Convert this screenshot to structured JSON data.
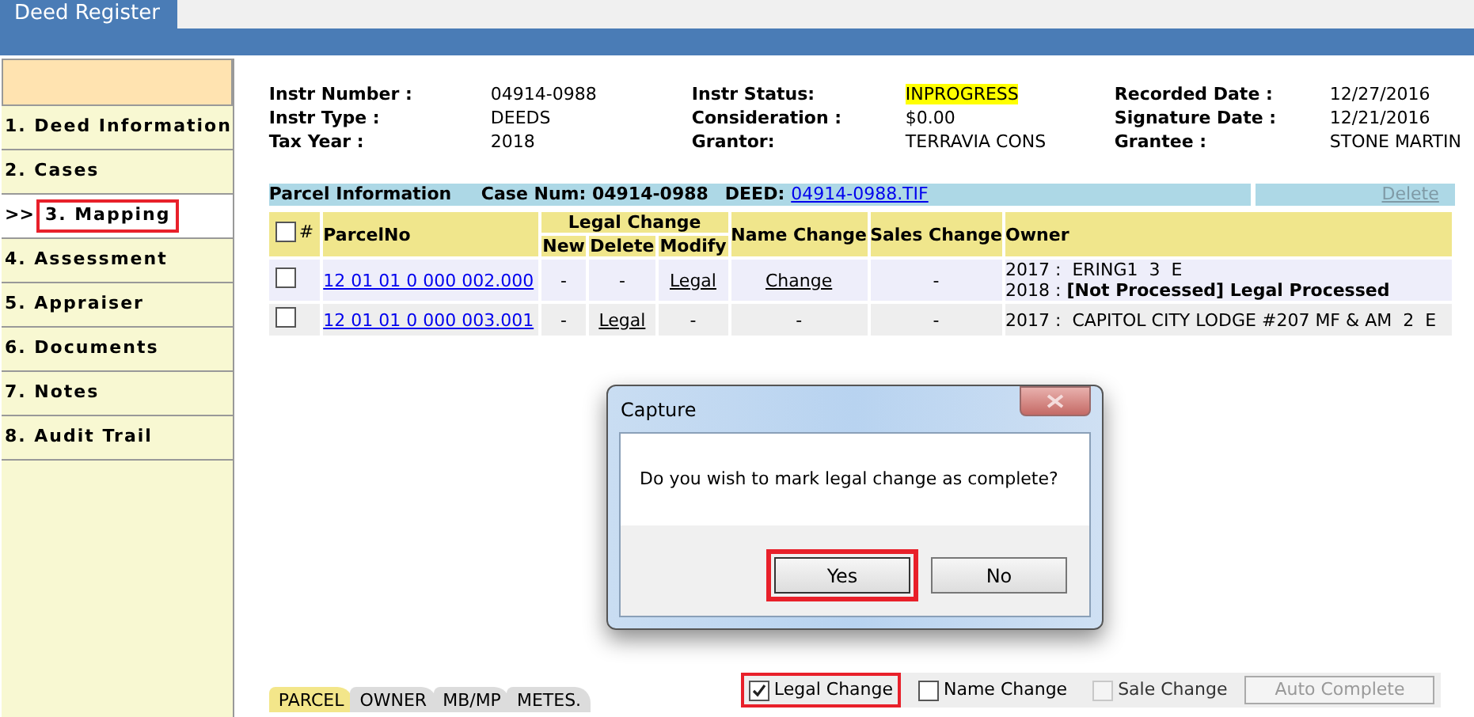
{
  "app_tab": "Deed Register",
  "sidebar": [
    {
      "label": "1. Deed Information",
      "selected": false,
      "highlighted": false
    },
    {
      "label": "2. Cases",
      "selected": false,
      "highlighted": false
    },
    {
      "label": "3. Mapping",
      "selected": true,
      "highlighted": true,
      "prefix": ">>"
    },
    {
      "label": "4. Assessment",
      "selected": false,
      "highlighted": false
    },
    {
      "label": "5. Appraiser",
      "selected": false,
      "highlighted": false
    },
    {
      "label": "6. Documents",
      "selected": false,
      "highlighted": false
    },
    {
      "label": "7. Notes",
      "selected": false,
      "highlighted": false
    },
    {
      "label": "8. Audit Trail",
      "selected": false,
      "highlighted": false
    }
  ],
  "info": [
    [
      {
        "label": "Instr Number :",
        "value": "04914-0988",
        "highlighted": false
      },
      {
        "label": "Instr Status:",
        "value": "INPROGRESS",
        "highlighted": true
      },
      {
        "label": "Recorded Date :",
        "value": "12/27/2016",
        "highlighted": false
      }
    ],
    [
      {
        "label": "Instr Type :",
        "value": "DEEDS",
        "highlighted": false
      },
      {
        "label": "Consideration :",
        "value": "$0.00",
        "highlighted": false
      },
      {
        "label": "Signature Date :",
        "value": "12/21/2016",
        "highlighted": false
      }
    ],
    [
      {
        "label": "Tax Year :",
        "value": "2018",
        "highlighted": false
      },
      {
        "label": "Grantor:",
        "value": "TERRAVIA CONS",
        "highlighted": false
      },
      {
        "label": "Grantee :",
        "value": "STONE MARTIN",
        "highlighted": false
      }
    ]
  ],
  "parcel_bar": {
    "title": "Parcel Information",
    "case_label": "Case Num: 04914-0988",
    "deed_label": "DEED:",
    "deed_link": "04914-0988.TIF",
    "delete": "Delete",
    "delete_disabled": true
  },
  "table": {
    "hash": "#",
    "parcel": "ParcelNo",
    "legal": "Legal Change",
    "legal_sub": [
      "New",
      "Delete",
      "Modify"
    ],
    "name_change": "Name Change",
    "sales_change": "Sales Change",
    "owner": "Owner",
    "all_checked": false,
    "rows": [
      {
        "checked": false,
        "parcel": "12 01 01 0 000 002.000",
        "cells": [
          {
            "text": "-",
            "kind": "plain"
          },
          {
            "text": "-",
            "kind": "plain"
          },
          {
            "text": "Legal",
            "kind": "link"
          },
          {
            "text": "Change",
            "kind": "link"
          },
          {
            "text": "-",
            "kind": "plain"
          }
        ],
        "owner": [
          "2017 :  ERING1  3  E",
          "2018 : **[Not Processed] Legal Processed**"
        ]
      },
      {
        "checked": false,
        "parcel": "12 01 01 0 000 003.001",
        "cells": [
          {
            "text": "-",
            "kind": "plain"
          },
          {
            "text": "Legal",
            "kind": "link"
          },
          {
            "text": "-",
            "kind": "plain"
          },
          {
            "text": "-",
            "kind": "plain"
          },
          {
            "text": "-",
            "kind": "plain"
          }
        ],
        "owner": [
          "2017 :  CAPITOL CITY LODGE #207 MF & AM  2  E"
        ]
      }
    ]
  },
  "dialog": {
    "title": "Capture",
    "message": "Do you wish to mark legal change as complete?",
    "buttons": [
      {
        "label": "Yes",
        "highlighted": true
      },
      {
        "label": "No",
        "highlighted": false
      }
    ]
  },
  "bottom_tabs": [
    {
      "label": "PARCEL",
      "selected": true
    },
    {
      "label": "OWNER",
      "selected": false
    },
    {
      "label": "MB/MP",
      "selected": false
    },
    {
      "label": "METES.",
      "selected": false
    }
  ],
  "checkboxes": [
    {
      "label": "Legal Change",
      "checked": true,
      "disabled": false,
      "highlighted": true
    },
    {
      "label": "Name Change",
      "checked": false,
      "disabled": false,
      "highlighted": false
    },
    {
      "label": "Sale Change",
      "checked": false,
      "disabled": true,
      "highlighted": false
    }
  ],
  "auto_complete": {
    "label": "Auto Complete",
    "disabled": true
  }
}
